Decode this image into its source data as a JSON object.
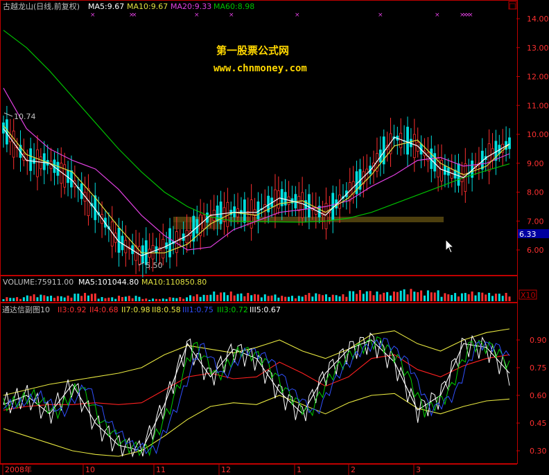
{
  "colors": {
    "bg": "#000000",
    "frame": "#c00000",
    "up": "#ff3030",
    "down": "#00e0e0",
    "ma5": "#ffffff",
    "ma10": "#e0e040",
    "ma20": "#e040e0",
    "ma60": "#00c000",
    "axis_text": "#ff3030",
    "watermark": "#ffd700",
    "ind_white": "#ffffff",
    "ind_green": "#00d000",
    "ind_blue": "#3050ff",
    "ind_red": "#ff2020",
    "ind_yellow": "#e8e840"
  },
  "header": {
    "title": "古越龙山(日线,前复权)",
    "ma5": "MA5:9.67",
    "ma10": "MA10:9.67",
    "ma20": "MA20:9.33",
    "ma60": "MA60:8.98",
    "window_button": "□"
  },
  "watermark": {
    "line1": "第一股票公式网",
    "line2": "www.chnmoney.com"
  },
  "price_panel": {
    "high_label": "10.74",
    "low_label": "5.50",
    "current_price": "6.33"
  },
  "volume_header": {
    "vol": "VOLUME:75911.00",
    "ma5": "MA5:101044.80",
    "ma10": "MA10:110850.80",
    "unit": "X10"
  },
  "indicator_header": {
    "name": "通达信副图10",
    "v1": "II3:0.92",
    "v2": "II4:0.68",
    "v3": "II7:0.98",
    "v4": "II8:0.58",
    "v5": "III1:0.75",
    "v6": "III3:0.72",
    "v7": "III5:0.67"
  },
  "x_axis": {
    "labels": [
      "2008年",
      "10",
      "11",
      "12",
      "1",
      "2",
      "3"
    ]
  },
  "chart_data": [
    {
      "type": "line",
      "panel": "price",
      "y_ticks": [
        "14.00",
        "13.00",
        "12.00",
        "11.00",
        "10.00",
        "9.00",
        "8.00",
        "7.00",
        "6.00"
      ],
      "ylim": [
        5.0,
        14.4
      ],
      "x_labels": [
        "2008年",
        "10",
        "11",
        "12",
        "1",
        "2",
        "3"
      ],
      "series": [
        {
          "name": "MA60",
          "values": [
            13.6,
            13.0,
            12.2,
            11.3,
            10.4,
            9.5,
            8.7,
            8.0,
            7.5,
            7.15,
            7.0,
            6.98,
            6.97,
            6.96,
            7.0,
            7.1,
            7.3,
            7.6,
            7.9,
            8.2,
            8.5,
            8.75,
            8.98
          ]
        },
        {
          "name": "MA20",
          "values": [
            11.6,
            10.2,
            9.5,
            9.1,
            8.8,
            8.1,
            7.2,
            6.5,
            6.0,
            6.1,
            6.7,
            7.0,
            7.3,
            7.4,
            7.5,
            7.7,
            8.2,
            8.6,
            9.1,
            9.2,
            8.9,
            9.0,
            9.33
          ]
        },
        {
          "name": "MA10",
          "values": [
            10.3,
            9.3,
            9.0,
            8.7,
            7.8,
            6.8,
            5.9,
            5.9,
            6.2,
            6.9,
            7.3,
            7.2,
            7.6,
            7.7,
            7.3,
            7.8,
            8.6,
            9.6,
            9.8,
            9.0,
            8.6,
            8.9,
            9.67
          ]
        },
        {
          "name": "MA5",
          "values": [
            10.2,
            9.1,
            9.0,
            8.4,
            7.4,
            6.3,
            5.8,
            6.1,
            6.5,
            7.2,
            7.3,
            7.3,
            7.8,
            7.6,
            7.2,
            8.0,
            8.8,
            9.9,
            9.6,
            8.8,
            8.5,
            9.2,
            9.67
          ]
        }
      ]
    },
    {
      "type": "bar",
      "panel": "volume",
      "series": [
        {
          "name": "VOLUME",
          "values": [
            3,
            5,
            4,
            6,
            3,
            4,
            2,
            3,
            5,
            7,
            6,
            5,
            4,
            6,
            5,
            8,
            7,
            9,
            8,
            6,
            7,
            6,
            5
          ]
        }
      ]
    },
    {
      "type": "line",
      "panel": "indicator",
      "y_ticks": [
        "0.90",
        "0.75",
        "0.60",
        "0.45",
        "0.30"
      ],
      "ylim": [
        0.26,
        1.0
      ],
      "series": [
        {
          "name": "upper",
          "values": [
            0.6,
            0.63,
            0.66,
            0.68,
            0.7,
            0.72,
            0.75,
            0.82,
            0.87,
            0.85,
            0.83,
            0.86,
            0.9,
            0.84,
            0.8,
            0.85,
            0.93,
            0.95,
            0.88,
            0.84,
            0.9,
            0.94,
            0.96
          ]
        },
        {
          "name": "mid",
          "values": [
            0.52,
            0.54,
            0.55,
            0.55,
            0.56,
            0.55,
            0.56,
            0.63,
            0.7,
            0.72,
            0.69,
            0.7,
            0.78,
            0.72,
            0.65,
            0.7,
            0.8,
            0.82,
            0.74,
            0.7,
            0.76,
            0.8,
            0.82
          ]
        },
        {
          "name": "lower",
          "values": [
            0.42,
            0.38,
            0.34,
            0.3,
            0.28,
            0.27,
            0.3,
            0.38,
            0.47,
            0.54,
            0.56,
            0.55,
            0.6,
            0.55,
            0.5,
            0.56,
            0.6,
            0.61,
            0.53,
            0.5,
            0.54,
            0.57,
            0.58
          ]
        },
        {
          "name": "II3",
          "values": [
            0.55,
            0.6,
            0.5,
            0.66,
            0.45,
            0.33,
            0.3,
            0.55,
            0.88,
            0.7,
            0.85,
            0.8,
            0.62,
            0.5,
            0.72,
            0.85,
            0.9,
            0.78,
            0.52,
            0.6,
            0.88,
            0.86,
            0.72
          ]
        }
      ]
    }
  ]
}
